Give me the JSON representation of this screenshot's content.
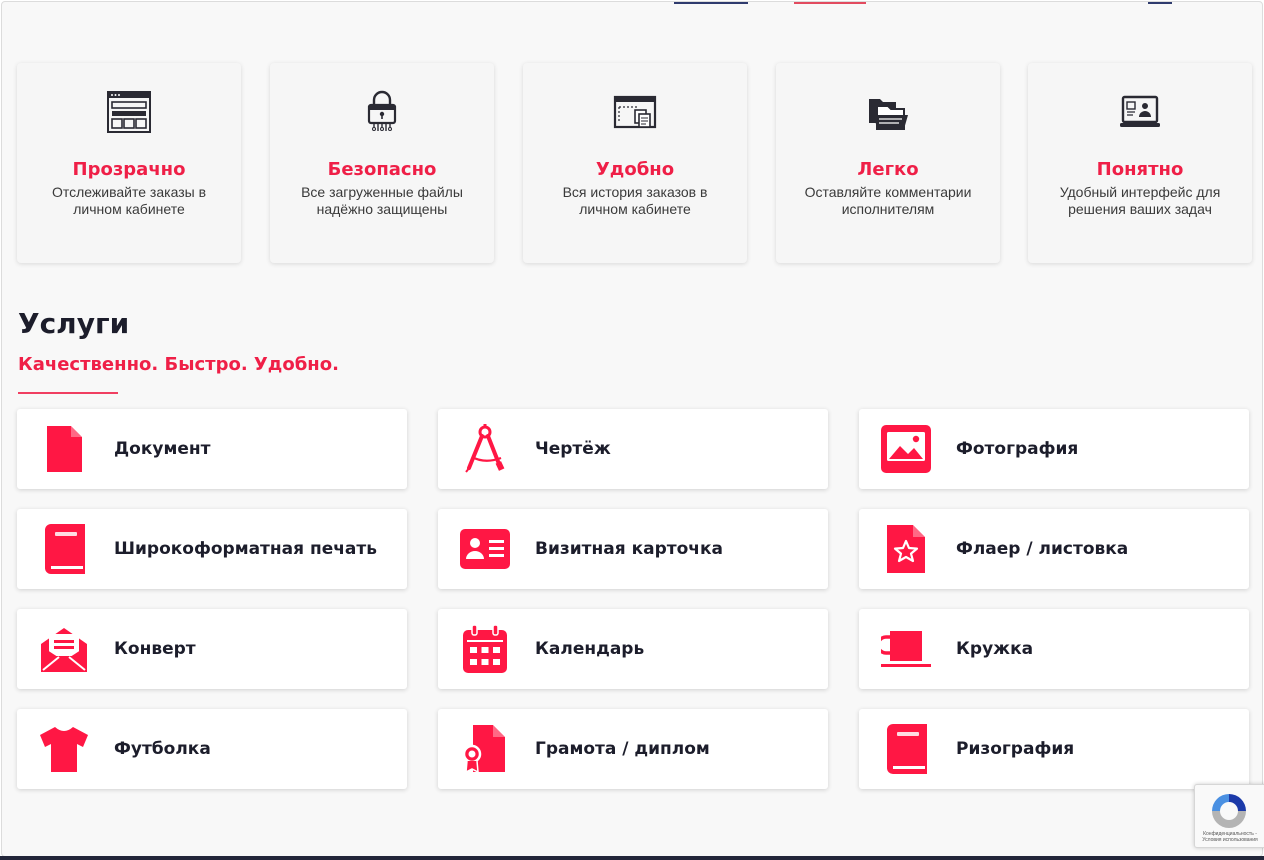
{
  "features": [
    {
      "title": "Прозрачно",
      "text": "Отслеживайте заказы в личном кабинете",
      "icon": "browser-window-icon"
    },
    {
      "title": "Безопасно",
      "text": "Все загруженные файлы надёжно защищены",
      "icon": "padlock-circuit-icon"
    },
    {
      "title": "Удобно",
      "text": "Вся история заказов в личном кабинете",
      "icon": "browser-documents-icon"
    },
    {
      "title": "Легко",
      "text": "Оставляйте комментарии исполнителям",
      "icon": "folders-icon"
    },
    {
      "title": "Понятно",
      "text": "Удобный интерфейс для решения ваших задач",
      "icon": "laptop-user-icon"
    }
  ],
  "services_section": {
    "title": "Услуги",
    "subtitle": "Качественно. Быстро. Удобно."
  },
  "services": [
    {
      "label": "Документ",
      "icon": "document-icon"
    },
    {
      "label": "Чертёж",
      "icon": "drafting-compass-icon"
    },
    {
      "label": "Фотография",
      "icon": "photo-icon"
    },
    {
      "label": "Широкоформатная печать",
      "icon": "book-icon"
    },
    {
      "label": "Визитная карточка",
      "icon": "id-card-icon"
    },
    {
      "label": "Флаер / листовка",
      "icon": "flyer-star-icon"
    },
    {
      "label": "Конверт",
      "icon": "envelope-open-icon"
    },
    {
      "label": "Календарь",
      "icon": "calendar-icon"
    },
    {
      "label": "Кружка",
      "icon": "mug-icon"
    },
    {
      "label": "Футболка",
      "icon": "tshirt-icon"
    },
    {
      "label": "Грамота / диплом",
      "icon": "certificate-icon"
    },
    {
      "label": "Ризография",
      "icon": "book-icon"
    }
  ],
  "recaptcha": {
    "text": "Конфиденциальность - Условия использования"
  },
  "colors": {
    "accent": "#ef1f47",
    "text_dark": "#1c1d2b",
    "background": "#f8f8f8"
  }
}
